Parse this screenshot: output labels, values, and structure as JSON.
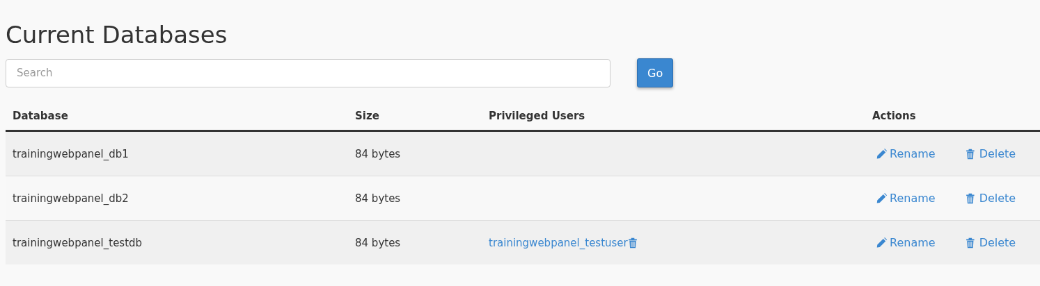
{
  "title": "Current Databases",
  "search": {
    "placeholder": "Search"
  },
  "go_button": "Go",
  "table": {
    "columns": [
      "Database",
      "Size",
      "Privileged Users",
      "Actions"
    ],
    "rows": [
      {
        "database": "trainingwebpanel_db1",
        "size": "84 bytes",
        "users": [],
        "actions": [
          "Rename",
          "Delete"
        ]
      },
      {
        "database": "trainingwebpanel_db2",
        "size": "84 bytes",
        "users": [],
        "actions": [
          "Rename",
          "Delete"
        ]
      },
      {
        "database": "trainingwebpanel_testdb",
        "size": "84 bytes",
        "users": [
          "trainingwebpanel_testuser"
        ],
        "actions": [
          "Rename",
          "Delete"
        ]
      }
    ]
  }
}
